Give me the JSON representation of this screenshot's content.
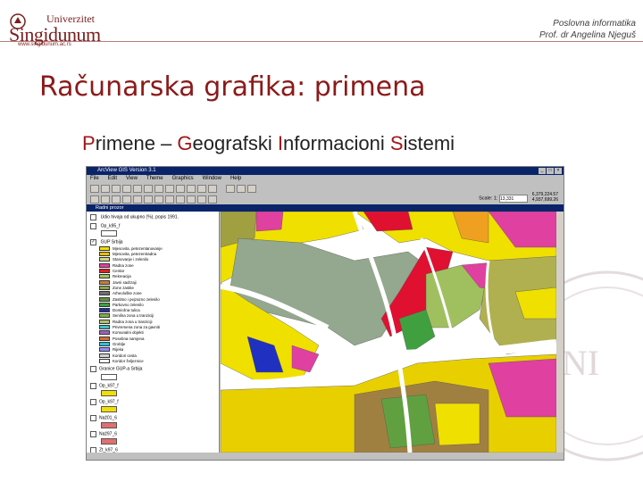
{
  "header": {
    "logo_top": "Univerzitet",
    "logo_name": "Singidunum",
    "logo_url": "www.singidunum.ac.rs",
    "course": "Poslovna informatika",
    "author": "Prof. dr Angelina Njeguš"
  },
  "slide": {
    "title": "Računarska grafika: primena",
    "subtitle_parts": [
      "P",
      "rimene – ",
      "G",
      "eografski ",
      "I",
      "nformacioni ",
      "S",
      "istemi"
    ]
  },
  "app": {
    "window_title": "ArcView GIS Version 3.1",
    "menu": [
      "File",
      "Edit",
      "View",
      "Theme",
      "Graphics",
      "Window",
      "Help"
    ],
    "scale_label": "Scale: 1:",
    "scale_value": "13,331",
    "coord_x": "6,379,224.57",
    "coord_y": "4,937,699.26",
    "view_title": "Radni prozor",
    "themes": [
      {
        "name": "Udio hivaja od ukupno (%), popis 1991.",
        "checked": false,
        "swatch": "#ffffff"
      },
      {
        "name": "Op_k95_f",
        "checked": false,
        "swatch": "#ffffff"
      },
      {
        "name": "GUP Srbija",
        "checked": true,
        "swatch": null
      }
    ],
    "legend": [
      {
        "label": "Mjesovita, petezentanovanje",
        "color": "#f0e000"
      },
      {
        "label": "Mjesovita, petezentradna",
        "color": "#e8c000"
      },
      {
        "label": "Stanovanje i zelenilo",
        "color": "#c8d880"
      },
      {
        "label": "Radna zone",
        "color": "#e040a0"
      },
      {
        "label": "Centar",
        "color": "#e02020"
      },
      {
        "label": "Rekreacija",
        "color": "#a0c060"
      },
      {
        "label": "Javni sadrzaji",
        "color": "#c08040"
      },
      {
        "label": "Zone zastite",
        "color": "#90a050"
      },
      {
        "label": "Arheološke zone",
        "color": "#707070"
      },
      {
        "label": "Zastitno i pejzazno zelenilo",
        "color": "#609040"
      },
      {
        "label": "Parkovno zelenilo",
        "color": "#40a040"
      },
      {
        "label": "Domicilna tulica",
        "color": "#2030a0"
      },
      {
        "label": "Senilna zona u tranziciji",
        "color": "#80b040"
      },
      {
        "label": "Radna zona u tranziciji",
        "color": "#b0c070"
      },
      {
        "label": "Privremena zona za gavniti",
        "color": "#40c0c0"
      },
      {
        "label": "Komunalni objekti",
        "color": "#a060c0"
      },
      {
        "label": "Posebna namjena",
        "color": "#d07030"
      },
      {
        "label": "Groblje",
        "color": "#30c0e0"
      },
      {
        "label": "Rijeka",
        "color": "#9090ff"
      },
      {
        "label": "Koridori cesta",
        "color": "#d0d0d0"
      },
      {
        "label": "Koridor željeznice",
        "color": "#ffffff"
      }
    ],
    "other_themes": [
      {
        "name": "Granice GUP-a Srbija",
        "swatch": "#ffffff"
      },
      {
        "name": "Op_k97_f",
        "swatch": "#f0e000"
      },
      {
        "name": "Op_k97_f",
        "swatch": "#f0e000"
      },
      {
        "name": "Naž01_6",
        "swatch": "#e07070"
      },
      {
        "name": "Naž97_6",
        "swatch": "#e07070"
      },
      {
        "name": "Zt_k97_6",
        "swatch": "#f0e000"
      }
    ]
  },
  "colors": {
    "accent": "#8b1a1a",
    "titlebar": "#0a246a"
  }
}
